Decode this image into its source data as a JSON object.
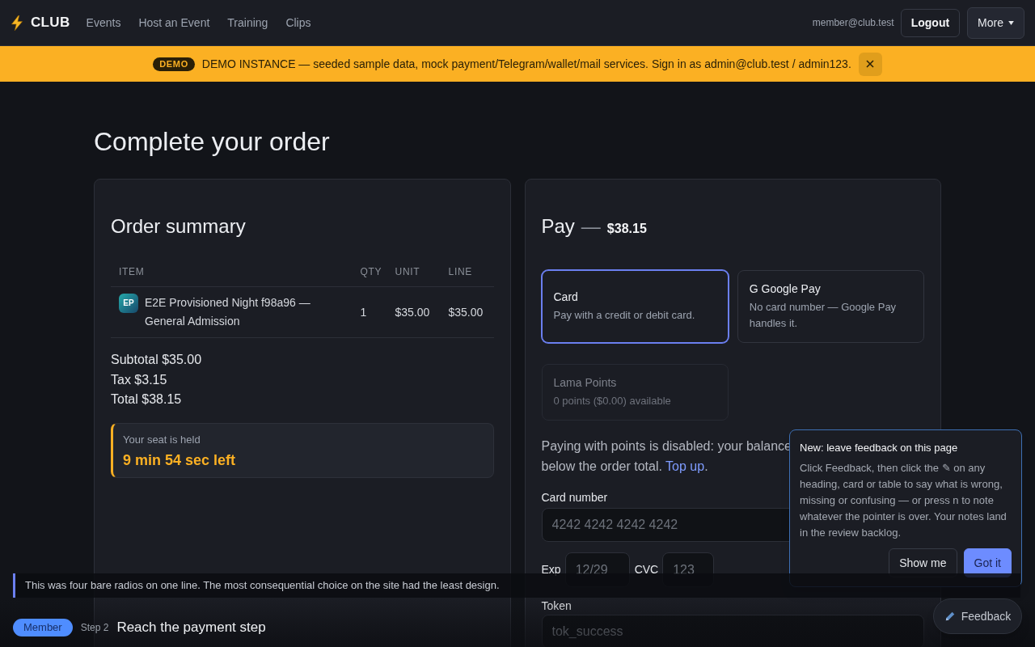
{
  "nav": {
    "logo": "CLUB",
    "links": [
      "Events",
      "Host an Event",
      "Training",
      "Clips"
    ],
    "user": "member@club.test",
    "logout": "Logout",
    "more": "More"
  },
  "banner": {
    "badge": "DEMO",
    "text": "DEMO INSTANCE — seeded sample data, mock payment/Telegram/wallet/mail services. Sign in as admin@club.test / admin123."
  },
  "page_title": "Complete your order",
  "order_summary": {
    "title": "Order summary",
    "columns": [
      "ITEM",
      "QTY",
      "UNIT",
      "LINE"
    ],
    "rows": [
      {
        "cells": [
          {
            "thumbnail": "EP",
            "text": "E2E Provisioned Night f98a96 — General Admission"
          },
          "1",
          "$35.00",
          "$35.00"
        ]
      }
    ],
    "totals": [
      "Subtotal $35.00",
      "Tax $3.15",
      "Total $38.15"
    ],
    "hold": {
      "label": "Your seat is held",
      "countdown": "9 min 54 sec left"
    }
  },
  "pay": {
    "title": "Pay",
    "separator": "—",
    "amount": "$38.15",
    "methods": [
      {
        "label": "Card",
        "description": "Pay with a credit or debit card.",
        "selected": true,
        "disabled": false
      },
      {
        "label": "G Google Pay",
        "description": "No card number — Google Pay handles it.",
        "selected": false,
        "disabled": false
      },
      {
        "label": "Lama Points",
        "description": "0 points ($0.00) available",
        "selected": false,
        "disabled": true
      }
    ],
    "points_notice": {
      "line_1": "Paying with points is disabled: your balance",
      "line_2": "below the order total.",
      "link": "Top up",
      "end": "."
    },
    "card_number": {
      "label": "Card number",
      "placeholder": "4242 4242 4242 4242"
    },
    "exp": {
      "label": "Exp",
      "placeholder": "12/29"
    },
    "cvc": {
      "label": "CVC",
      "placeholder": "123"
    },
    "token": {
      "label": "Token",
      "placeholder": "tok_success"
    }
  },
  "caption": "This was four bare radios on one line. The most consequential choice on the site had the least design.",
  "step_bar": {
    "role": "Member",
    "step": "Step 2",
    "title": "Reach the payment step"
  },
  "feedback_tip": {
    "title": "New: leave feedback on this page",
    "body": "Click Feedback, then click the ✎ on any heading, card or table to say what is wrong, missing or confusing — or press n to note whatever the pointer is over. Your notes land in the review backlog.",
    "buttons": [
      {
        "label": "Show me",
        "kind": "secondary"
      },
      {
        "label": "Got it",
        "kind": "primary"
      }
    ]
  },
  "feedback_button": "Feedback"
}
